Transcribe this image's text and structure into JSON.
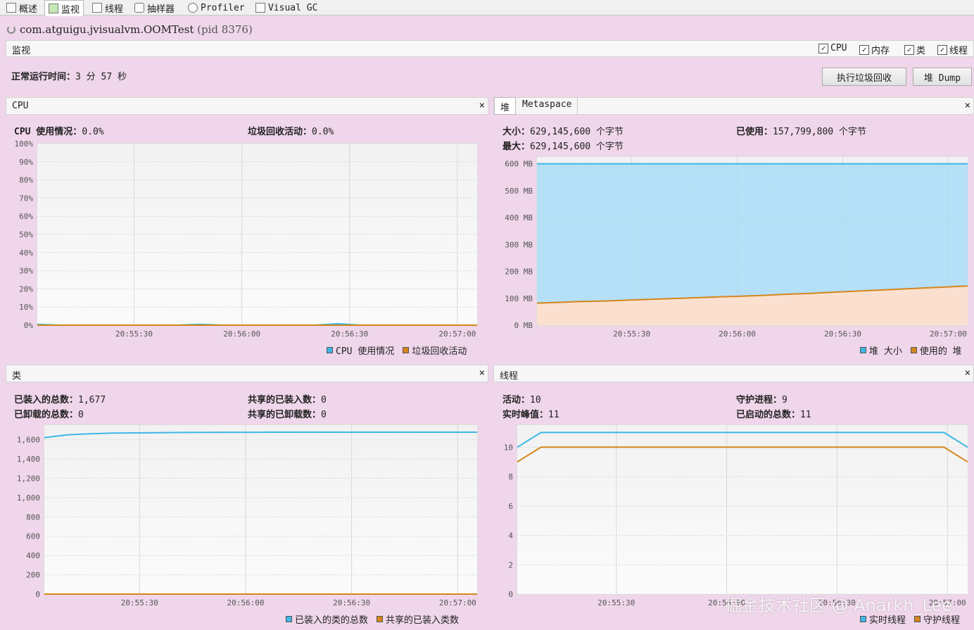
{
  "tabs": [
    {
      "label": "概述",
      "icon": "overview-icon"
    },
    {
      "label": "监视",
      "icon": "monitor-icon"
    },
    {
      "label": "线程",
      "icon": "threads-icon"
    },
    {
      "label": "抽样器",
      "icon": "sampler-icon"
    },
    {
      "label": "Profiler",
      "icon": "profiler-icon"
    },
    {
      "label": "Visual GC",
      "icon": "visualgc-icon"
    }
  ],
  "app": {
    "name": "com.atguigu.jvisualvm.OOMTest",
    "pid": "(pid 8376)"
  },
  "monitor": {
    "label": "监视",
    "checks": [
      {
        "label": "CPU",
        "checked": true
      },
      {
        "label": "内存",
        "checked": true
      },
      {
        "label": "类",
        "checked": true
      },
      {
        "label": "线程",
        "checked": true
      }
    ],
    "uptime_label": "正常运行时间：",
    "uptime_value": "3 分 57 秒",
    "gc_button": "执行垃圾回收",
    "dump_button": "堆 Dump"
  },
  "cpu": {
    "title": "CPU",
    "usage_label": "CPU 使用情况：",
    "usage_value": "0.0%",
    "gc_label": "垃圾回收活动：",
    "gc_value": "0.0%",
    "legend": [
      "CPU 使用情况",
      "垃圾回收活动"
    ]
  },
  "heap": {
    "tab_heap": "堆",
    "tab_meta": "Metaspace",
    "size_label": "大小：",
    "size_value": "629,145,600 个字节",
    "used_label": "已使用：",
    "used_value": "157,799,800 个字节",
    "max_label": "最大：",
    "max_value": "629,145,600 个字节",
    "legend": [
      "堆 大小",
      "使用的 堆"
    ]
  },
  "classes": {
    "title": "类",
    "loaded_label": "已装入的总数：",
    "loaded_value": "1,677",
    "unloaded_label": "已卸载的总数：",
    "unloaded_value": "0",
    "shared_loaded_label": "共享的已装入数：",
    "shared_loaded_value": "0",
    "shared_unloaded_label": "共享的已卸载数：",
    "shared_unloaded_value": "0",
    "legend": [
      "已装入的类的总数",
      "共享的已装入类数"
    ]
  },
  "threads": {
    "title": "线程",
    "live_label": "活动：",
    "live_value": "10",
    "peak_label": "实时峰值：",
    "peak_value": "11",
    "daemon_label": "守护进程：",
    "daemon_value": "9",
    "started_label": "已启动的总数：",
    "started_value": "11",
    "legend": [
      "实时线程",
      "守护线程"
    ]
  },
  "watermark": "掘金技术社区 @ Anarkh_Lee",
  "colors": {
    "blue": "#3fb6e6",
    "orange": "#d3861c",
    "bg": "#efd6ea"
  },
  "chart_data": [
    {
      "type": "line",
      "x_ticks": [
        "20:55:30",
        "20:56:00",
        "20:56:30",
        "20:57:00"
      ],
      "y_ticks": [
        "100%",
        "90%",
        "80%",
        "70%",
        "60%",
        "50%",
        "40%",
        "30%",
        "20%",
        "10%",
        "0%"
      ],
      "ylim": [
        0,
        100
      ],
      "series": [
        {
          "name": "CPU 使用情况",
          "values": [
            0.5,
            0,
            0,
            0,
            0,
            0,
            0,
            0.5,
            0,
            0,
            0,
            0,
            0,
            0.8,
            0,
            0,
            0,
            0,
            0,
            0
          ]
        },
        {
          "name": "垃圾回收活动",
          "values": [
            0,
            0,
            0,
            0,
            0,
            0,
            0,
            0,
            0,
            0,
            0,
            0,
            0,
            0,
            0,
            0,
            0,
            0,
            0,
            0
          ]
        }
      ]
    },
    {
      "type": "area",
      "x_ticks": [
        "20:55:30",
        "20:56:00",
        "20:56:30",
        "20:57:00"
      ],
      "y_ticks": [
        "600 MB",
        "500 MB",
        "400 MB",
        "300 MB",
        "200 MB",
        "100 MB",
        "0 MB"
      ],
      "ylim": [
        0,
        625
      ],
      "series": [
        {
          "name": "堆 大小",
          "values": [
            600,
            600,
            600,
            600,
            600,
            600,
            600,
            600,
            600,
            600,
            600,
            600,
            600,
            600,
            600,
            600,
            600,
            600,
            600,
            600
          ]
        },
        {
          "name": "使用的 堆",
          "values": [
            82,
            85,
            88,
            90,
            93,
            96,
            99,
            102,
            105,
            108,
            111,
            115,
            118,
            122,
            126,
            130,
            134,
            138,
            142,
            146
          ]
        }
      ]
    },
    {
      "type": "line",
      "x_ticks": [
        "20:55:30",
        "20:56:00",
        "20:56:30",
        "20:57:00"
      ],
      "y_ticks": [
        "1,600",
        "1,400",
        "1,200",
        "1,000",
        "800",
        "600",
        "400",
        "200",
        "0"
      ],
      "ylim": [
        0,
        1750
      ],
      "series": [
        {
          "name": "已装入的类的总数",
          "values": [
            1620,
            1650,
            1660,
            1668,
            1670,
            1672,
            1674,
            1675,
            1676,
            1676,
            1677,
            1677,
            1677,
            1677,
            1677,
            1677,
            1677,
            1677,
            1677,
            1677
          ]
        },
        {
          "name": "共享的已装入类数",
          "values": [
            0,
            0,
            0,
            0,
            0,
            0,
            0,
            0,
            0,
            0,
            0,
            0,
            0,
            0,
            0,
            0,
            0,
            0,
            0,
            0
          ]
        }
      ]
    },
    {
      "type": "line",
      "x_ticks": [
        "20:55:30",
        "20:56:00",
        "20:56:30",
        "20:57:00"
      ],
      "y_ticks": [
        "10",
        "8",
        "6",
        "4",
        "2",
        "0"
      ],
      "ylim": [
        0,
        11.5
      ],
      "series": [
        {
          "name": "实时线程",
          "values": [
            10,
            11,
            11,
            11,
            11,
            11,
            11,
            11,
            11,
            11,
            11,
            11,
            11,
            11,
            11,
            11,
            11,
            11,
            11,
            10
          ]
        },
        {
          "name": "守护线程",
          "values": [
            9,
            10,
            10,
            10,
            10,
            10,
            10,
            10,
            10,
            10,
            10,
            10,
            10,
            10,
            10,
            10,
            10,
            10,
            10,
            9
          ]
        }
      ]
    }
  ]
}
